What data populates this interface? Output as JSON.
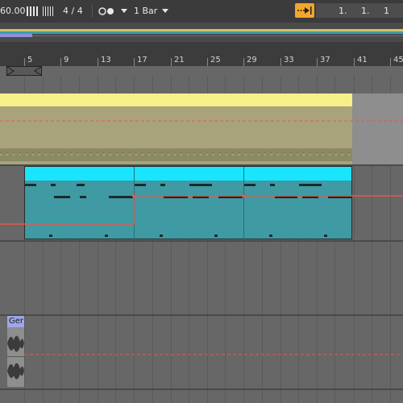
{
  "transport": {
    "tempo_display": "60.00",
    "time_signature": "4 / 4",
    "quantization": "1 Bar",
    "position": {
      "bar": "1.",
      "beat": "1.",
      "sixteenth": "1"
    }
  },
  "ruler": {
    "bar_labels": [
      "5",
      "9",
      "13",
      "17",
      "21",
      "25",
      "29",
      "33",
      "37",
      "41",
      "45"
    ]
  },
  "clips": {
    "audio_clip_title": "Ger"
  },
  "colors": {
    "audio_track_clip": "#f6f08a",
    "midi_clip_title": "#19e5ff",
    "midi_clip_body": "#3f9aa3",
    "automation_line": "#e8574a",
    "follow_button": "#f2a62c",
    "audio_clip_title": "#9fa6e8"
  },
  "icons": {
    "follow": "follow-arrow-icon",
    "metronome": "metronome-dots-icon",
    "dropdown": "chevron-down-icon",
    "tap": "bar-meter-icon"
  }
}
